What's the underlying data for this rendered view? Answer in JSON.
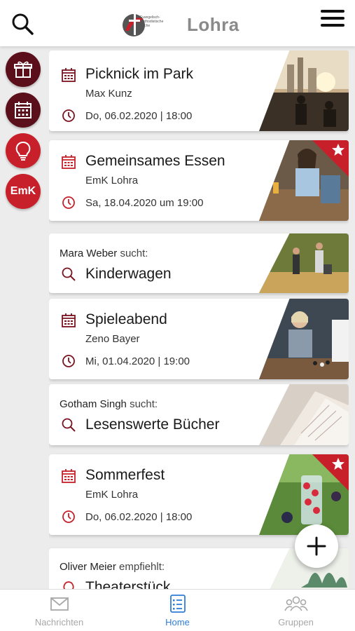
{
  "header": {
    "title": "Lohra",
    "logo_text": "Evangelisch-methodistische Kirche",
    "search_icon": "search-icon",
    "menu_icon": "hamburger-menu-icon"
  },
  "side_nav": [
    {
      "icon": "gift-icon",
      "color": "#5a0f1a"
    },
    {
      "icon": "calendar-icon",
      "color": "#5a0f1a"
    },
    {
      "icon": "lightbulb-icon",
      "color": "#c8202a"
    },
    {
      "label": "EmK",
      "color": "#c8202a"
    }
  ],
  "cards": {
    "c1": {
      "title": "Picknick im Park",
      "host": "Max Kunz",
      "date": "Do, 06.02.2020 | 18:00"
    },
    "c2": {
      "title": "Gemeinsames Essen",
      "host": "EmK Lohra",
      "date": "Sa, 18.04.2020 um 19:00",
      "featured": true
    },
    "c3": {
      "person": "Mara Weber",
      "verb": "sucht:",
      "item": "Kinderwagen"
    },
    "c4": {
      "title": "Spieleabend",
      "host": "Zeno Bayer",
      "date": "Mi, 01.04.2020 | 19:00"
    },
    "c5": {
      "person": "Gotham Singh",
      "verb": "sucht:",
      "item": "Lesenswerte Bücher"
    },
    "c6": {
      "title": "Sommerfest",
      "host": "EmK Lohra",
      "date": "Do, 06.02.2020 | 18:00",
      "featured": true
    },
    "c7": {
      "person": "Oliver Meier",
      "verb": "empfiehlt:",
      "item": "Theaterstück"
    }
  },
  "bottom_nav": {
    "messages": "Nachrichten",
    "home": "Home",
    "groups": "Gruppen"
  },
  "colors": {
    "accent": "#c8202a",
    "dark": "#5a0f1a",
    "active_tab": "#2f7dd6"
  }
}
